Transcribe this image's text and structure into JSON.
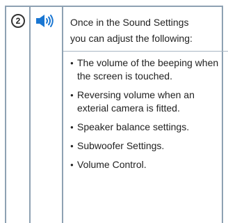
{
  "step": {
    "number": "2"
  },
  "icon": {
    "name": "speaker-volume-icon",
    "color": "#1976d2"
  },
  "intro_lines": [
    "Once in the Sound Settings",
    "you can adjust the following:"
  ],
  "bullets": [
    "The volume of the beeping when the screen is touched.",
    "Reversing volume when an exterial camera is fitted.",
    "Speaker balance settings.",
    "Subwoofer Settings.",
    "Volume Control."
  ],
  "colors": {
    "table_border": "#8ea1b2",
    "row_divider": "#a8b6c3"
  }
}
